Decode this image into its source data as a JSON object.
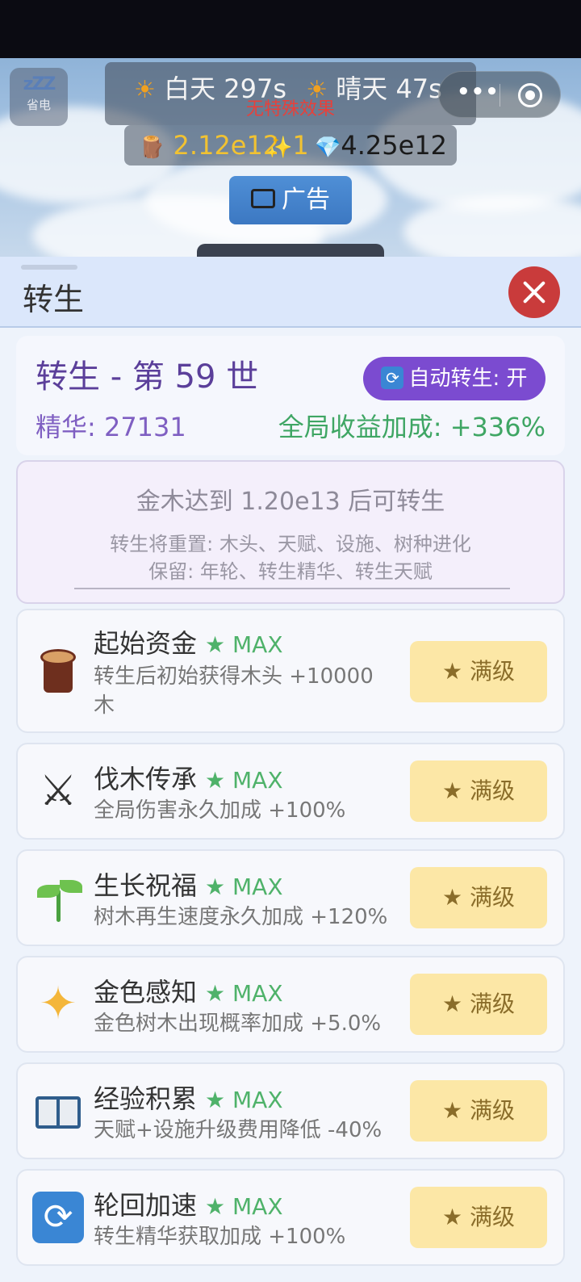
{
  "hud": {
    "sleep_label": "省电",
    "sleep_icon": "zzz-icon",
    "weather": {
      "time_of_day": "白天 297s",
      "weather": "晴天 47s",
      "effect": "无特殊效果"
    },
    "resources": {
      "wood": "2.12e12",
      "sparkle": "1",
      "gem": "4.25e12"
    },
    "ad_label": "广告"
  },
  "sheet": {
    "title": "转生",
    "info": {
      "title": "转生 - 第 59 世",
      "auto_label": "自动转生: 开",
      "essence": "精华: 27131",
      "bonus": "全局收益加成: +336%"
    },
    "requirement": {
      "main": "金木达到 1.20e13 后可转生",
      "resets": "转生将重置: 木头、天赋、设施、树种进化",
      "keeps": "保留: 年轮、转生精华、转生天赋"
    },
    "talents": [
      {
        "name": "起始资金",
        "max": "★ MAX",
        "desc": "转生后初始获得木头 +10000 木",
        "button": "★ 满级",
        "icon": "log-icon"
      },
      {
        "name": "伐木传承",
        "max": "★ MAX",
        "desc": "全局伤害永久加成 +100%",
        "button": "★ 满级",
        "icon": "crossed-swords-icon"
      },
      {
        "name": "生长祝福",
        "max": "★ MAX",
        "desc": "树木再生速度永久加成 +120%",
        "button": "★ 满级",
        "icon": "sprout-icon"
      },
      {
        "name": "金色感知",
        "max": "★ MAX",
        "desc": "金色树木出现概率加成 +5.0%",
        "button": "★ 满级",
        "icon": "sparkles-icon"
      },
      {
        "name": "经验积累",
        "max": "★ MAX",
        "desc": "天赋+设施升级费用降低 -40%",
        "button": "★ 满级",
        "icon": "book-icon"
      },
      {
        "name": "轮回加速",
        "max": "★ MAX",
        "desc": "转生精华获取加成 +100%",
        "button": "★ 满级",
        "icon": "cycle-icon"
      }
    ]
  },
  "colors": {
    "accent_purple": "#7b4bd0",
    "bonus_green": "#3fa664",
    "close_red": "#c93b3b",
    "max_button_bg": "#fce7a6"
  }
}
